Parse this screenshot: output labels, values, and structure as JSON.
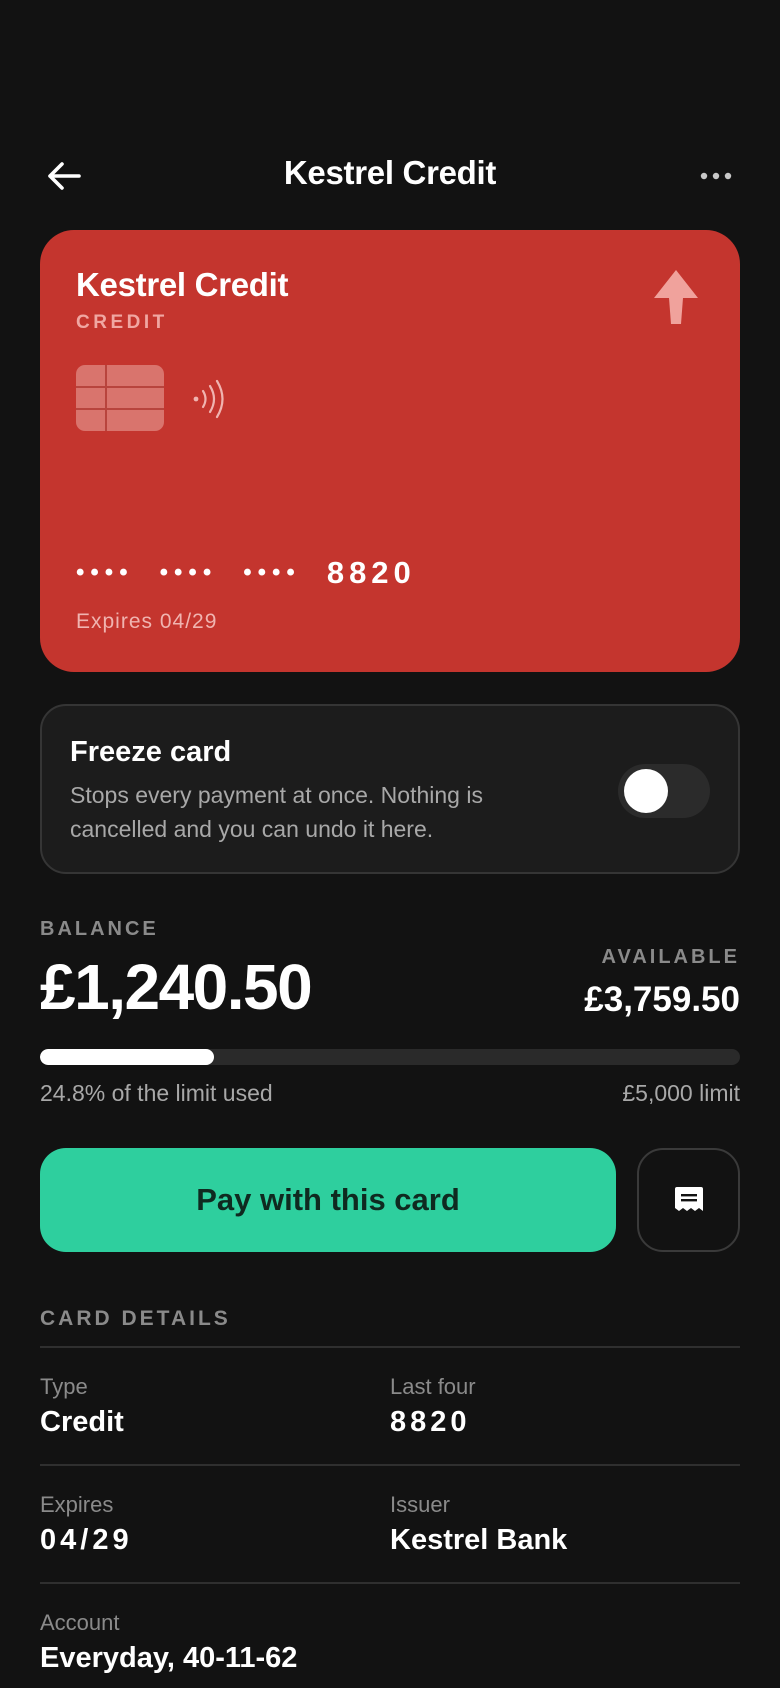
{
  "header": {
    "title": "Kestrel Credit"
  },
  "card": {
    "name": "Kestrel Credit",
    "type_label": "CREDIT",
    "masked_groups": [
      "••••",
      "••••",
      "••••"
    ],
    "last_four": "8820",
    "expiry_text": "Expires 04/29",
    "color": "#c4352e"
  },
  "freeze": {
    "title": "Freeze card",
    "description": "Stops every payment at once. Nothing is cancelled and you can undo it here.",
    "enabled": false
  },
  "balance": {
    "label": "BALANCE",
    "value": "£1,240.50",
    "available_label": "AVAILABLE",
    "available_value": "£3,759.50",
    "used_fraction": 0.248,
    "used_text": "24.8% of the limit used",
    "limit_text": "£5,000 limit"
  },
  "actions": {
    "pay_label": "Pay with this card",
    "accent": "#2ecf9e"
  },
  "details": {
    "section_title": "CARD DETAILS",
    "type_label": "Type",
    "type_value": "Credit",
    "last_four_label": "Last four",
    "last_four_value": "8820",
    "expires_label": "Expires",
    "expires_value": "04/29",
    "issuer_label": "Issuer",
    "issuer_value": "Kestrel Bank",
    "account_label": "Account",
    "account_value": "Everyday, 40-11-62"
  },
  "icons": {
    "back": "arrow-left-icon",
    "more": "more-horizontal-icon",
    "logo": "arrow-up-icon",
    "chip": "chip-icon",
    "contactless": "contactless-icon",
    "message": "receipt-icon"
  }
}
